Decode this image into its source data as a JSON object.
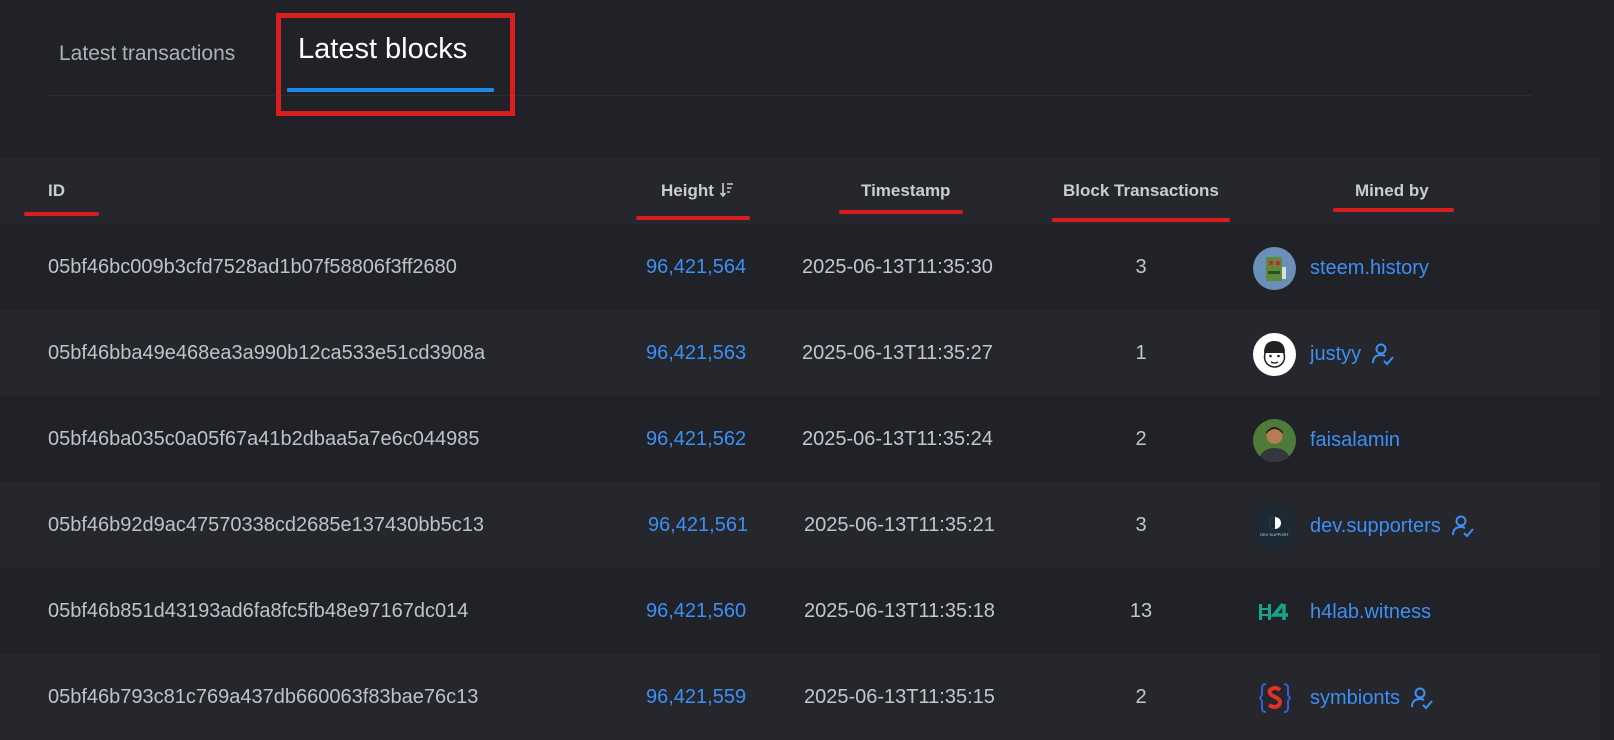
{
  "tabs": [
    {
      "label": "Latest transactions",
      "active": false
    },
    {
      "label": "Latest blocks",
      "active": true
    }
  ],
  "colors": {
    "accent": "#3d8ff5",
    "tab_indicator": "#1e88e5",
    "annotation_red": "#d91e22",
    "background": "#202227",
    "row_alt": "#25272d"
  },
  "table": {
    "columns": {
      "id": "ID",
      "height": "Height",
      "timestamp": "Timestamp",
      "block_transactions": "Block Transactions",
      "mined_by": "Mined by"
    },
    "sort_icon": "sort-descending-icon",
    "rows": [
      {
        "id": "05bf46bc009b3cfd7528ad1b07f58806f3ff2680",
        "height": "96,421,564",
        "timestamp": "2025-06-13T11:35:30",
        "tx": "3",
        "miner": "steem.history",
        "verified": false,
        "avatar": "pixel-character-avatar"
      },
      {
        "id": "05bf46bba49e468ea3a990b12ca533e51cd3908a",
        "height": "96,421,563",
        "timestamp": "2025-06-13T11:35:27",
        "tx": "1",
        "miner": "justyy",
        "verified": true,
        "avatar": "cartoon-face-avatar"
      },
      {
        "id": "05bf46ba035c0a05f67a41b2dbaa5a7e6c044985",
        "height": "96,421,562",
        "timestamp": "2025-06-13T11:35:24",
        "tx": "2",
        "miner": "faisalamin",
        "verified": false,
        "avatar": "person-photo-avatar"
      },
      {
        "id": "05bf46b92d9ac47570338cd2685e137430bb5c13",
        "height": "96,421,561",
        "timestamp": "2025-06-13T11:35:21",
        "tx": "3",
        "miner": "dev.supporters",
        "verified": true,
        "avatar": "dev-support-logo-avatar",
        "avatar_text": "DEV SUPPORT"
      },
      {
        "id": "05bf46b851d43193ad6fa8fc5fb48e97167dc014",
        "height": "96,421,560",
        "timestamp": "2025-06-13T11:35:18",
        "tx": "13",
        "miner": "h4lab.witness",
        "verified": false,
        "avatar": "h4-logo-avatar"
      },
      {
        "id": "05bf46b793c81c769a437db660063f83bae76c13",
        "height": "96,421,559",
        "timestamp": "2025-06-13T11:35:15",
        "tx": "2",
        "miner": "symbionts",
        "verified": true,
        "avatar": "symbionts-s-logo-avatar"
      }
    ]
  }
}
